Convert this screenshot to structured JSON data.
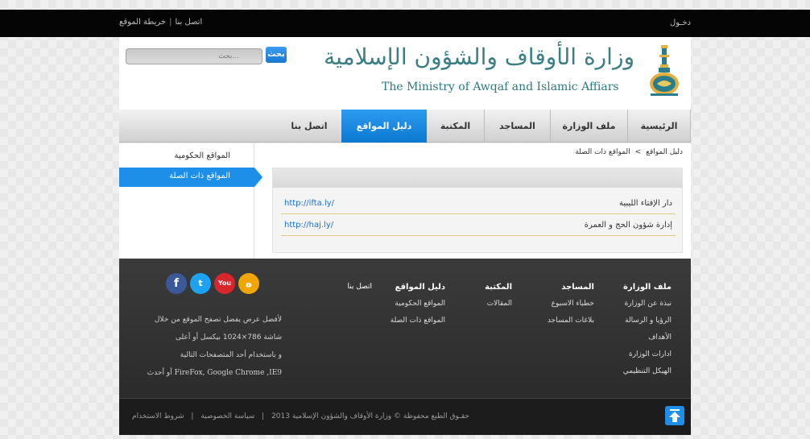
{
  "topbar": {
    "contact_label": "اتصل بنا",
    "sitemap_label": "خريطة الموقع",
    "separator": "|",
    "login_label": "دخـول"
  },
  "header": {
    "search_button": "بحث",
    "search_placeholder": "بحث...",
    "logo_arabic": "وزارة الأوقاف والشؤون الإسلامية",
    "logo_english": "The Ministry of Awqaf and Islamic Affiars"
  },
  "nav": {
    "items": [
      {
        "label": "الرئيسية"
      },
      {
        "label": "ملف الوزارة"
      },
      {
        "label": "المساجد"
      },
      {
        "label": "المكتبة"
      },
      {
        "label": "دليل المواقع"
      },
      {
        "label": "اتصل بنا"
      }
    ],
    "active_index": 4
  },
  "sidebar": {
    "items": [
      {
        "label": "المواقع الحكومية"
      },
      {
        "label": "المواقع ذات الصلة"
      }
    ],
    "active_index": 1
  },
  "breadcrumb": {
    "parent": "دليل المواقع",
    "separator": ">",
    "current": "المواقع ذات الصلة"
  },
  "links": [
    {
      "name": "دار الإفتاء الليبية",
      "url": "http://ifta.ly/"
    },
    {
      "name": "إدارة شؤون الحج و العمرة",
      "url": "http://haj.ly/"
    }
  ],
  "footer": {
    "col1": {
      "title": "ملف الوزارة",
      "items": [
        "نبذة عن الوزارة",
        "الرؤيا و الرسالة",
        "الأهداف",
        "ادارات الوزارة",
        "الهيكل التنظيمي"
      ]
    },
    "col2": {
      "title": "المساجد",
      "items": [
        "خطباء الاسبوع",
        "بلاغات المساجد"
      ]
    },
    "col3": {
      "title": "المكتبة",
      "items": [
        "المقالات"
      ]
    },
    "col4": {
      "title": "دليل المواقع",
      "items": [
        "المواقع الحكومية",
        "المواقع ذات الصلة"
      ]
    },
    "col5": {
      "title": "",
      "items": [
        "اتصل بنا"
      ]
    },
    "note_line1": "لأفضل عرض يفضل تصفح الموقع من خلال",
    "note_line2": "شاشة 786×1024 بيكسل أو أعلى",
    "note_line3": "و باستخدام أحد المتصفحات التالية",
    "note_line4": "FireFox, Google Chrome ,IE9 أو أحدث",
    "copyright": "حقـوق الطبع محفوظة © وزارة الأوقاف والشؤون الإسلامية 2013",
    "privacy_label": "سياسة الخصوصية",
    "terms_label": "شروط الاستخدام",
    "separator": "|"
  },
  "social": [
    {
      "icon": "facebook-icon",
      "glyph": "f",
      "color": "#3b5998"
    },
    {
      "icon": "twitter-icon",
      "glyph": "t",
      "color": "#1da1f2"
    },
    {
      "icon": "youtube-icon",
      "glyph": "You",
      "color": "#d8272c"
    },
    {
      "icon": "soundcloud-icon",
      "glyph": "ە",
      "color": "#f0a500"
    }
  ],
  "colors": {
    "accent": "#1e8fe8",
    "topbar": "#050505",
    "footer": "#2f2f2f",
    "link": "#1e6fc8"
  }
}
